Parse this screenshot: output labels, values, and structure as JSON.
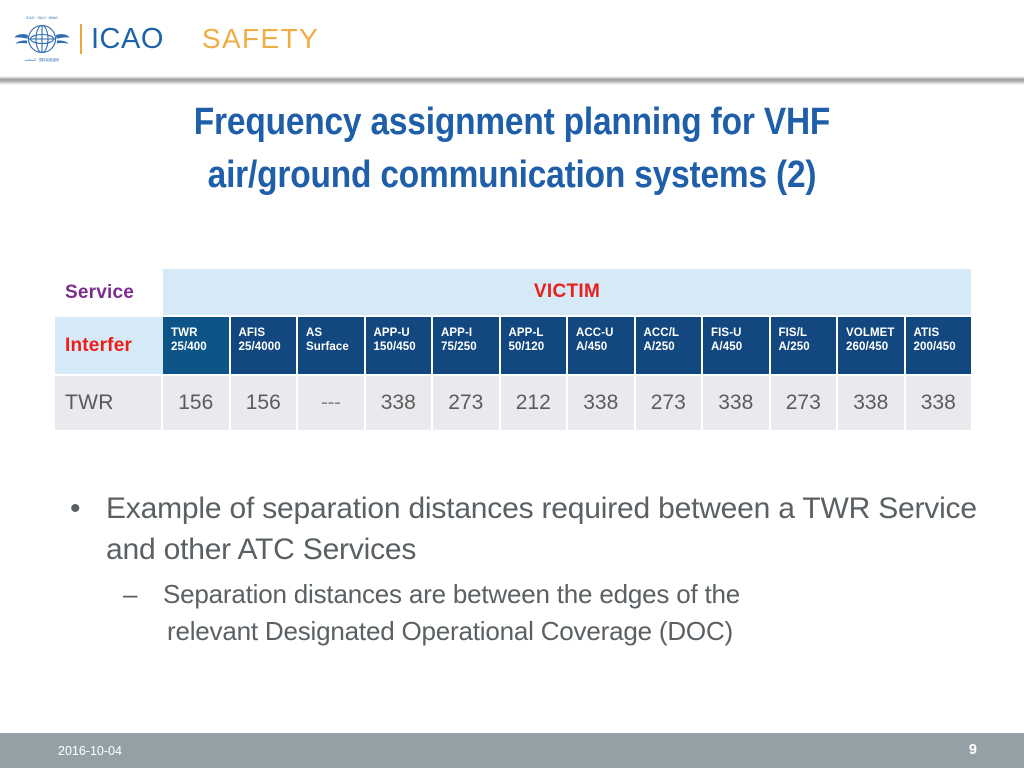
{
  "header": {
    "logo_icon": "icao-globe-wings-logo",
    "brand_name": "ICAO",
    "brand_sub": "SAFETY",
    "brand_color": "#1d63a8",
    "safety_color": "#f0ac45"
  },
  "title": {
    "line1": "Frequency assignment planning for VHF",
    "line2": "air/ground communication systems (2)",
    "color": "#1f5fa9"
  },
  "table": {
    "service_label": "Service",
    "victim_label": "VICTIM",
    "interfer_label": "Interfer",
    "service_color": "#7b2d8e",
    "victim_color": "#e8201b",
    "interfer_color": "#ef1d15",
    "header_bg": "#12477f",
    "banner_bg": "#d6e9f6",
    "data_bg": "#e8eaed",
    "columns": [
      {
        "name": "TWR",
        "range": "25/400"
      },
      {
        "name": "AFIS",
        "range": "25/4000"
      },
      {
        "name": "AS",
        "range": "Surface"
      },
      {
        "name": "APP-U",
        "range": "150/450"
      },
      {
        "name": "APP-I",
        "range": "75/250"
      },
      {
        "name": "APP-L",
        "range": "50/120"
      },
      {
        "name": "ACC-U",
        "range": "A/450"
      },
      {
        "name": "ACC/L",
        "range": "A/250"
      },
      {
        "name": "FIS-U",
        "range": "A/450"
      },
      {
        "name": "FIS/L",
        "range": "A/250"
      },
      {
        "name": "VOLMET",
        "range": "260/450"
      },
      {
        "name": "ATIS",
        "range": "200/450"
      }
    ],
    "rows": [
      {
        "label": "TWR",
        "values": [
          "156",
          "156",
          "---",
          "338",
          "273",
          "212",
          "338",
          "273",
          "338",
          "273",
          "338",
          "338"
        ]
      }
    ]
  },
  "bullets": {
    "level1": "Example of separation distances required between a TWR Service and other ATC Services",
    "level2_line1": "Separation distances are between the edges of the",
    "level2_line2": "relevant Designated Operational Coverage (DOC)",
    "bullet_glyph": "•",
    "dash_glyph": "–"
  },
  "footer": {
    "date": "2016-10-04",
    "page_number": "9",
    "bg_color": "#93a1a6"
  }
}
